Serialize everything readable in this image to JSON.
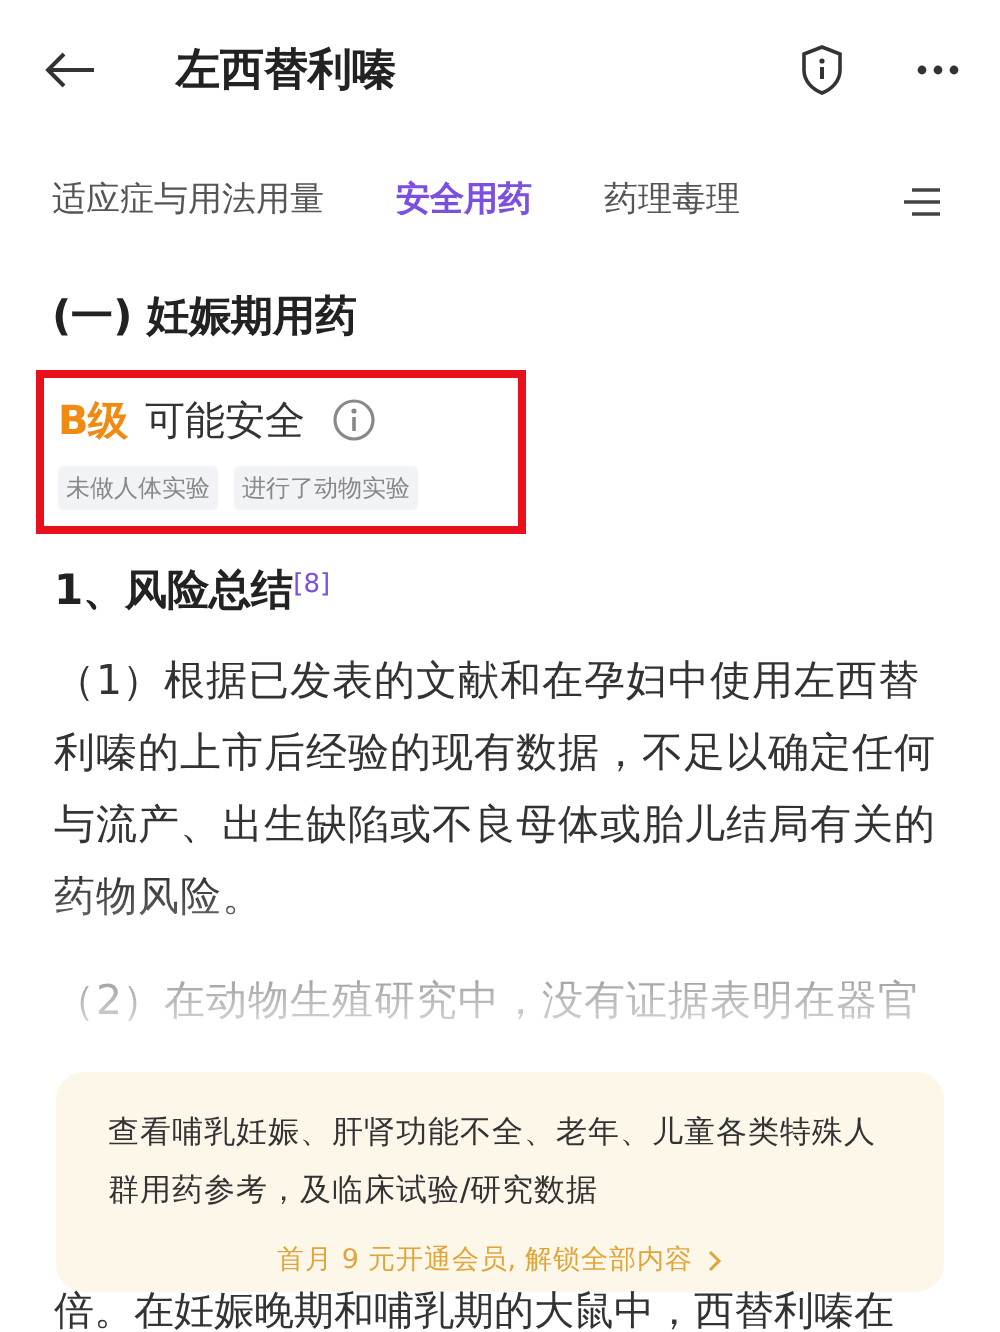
{
  "header": {
    "title": "左西替利嗪"
  },
  "tabs": [
    {
      "label": "适应症与用法用量",
      "selected": false
    },
    {
      "label": "安全用药",
      "selected": true
    },
    {
      "label": "药理毒理",
      "selected": false
    }
  ],
  "section_title": "(一) 妊娠期用药",
  "rating": {
    "grade": "B级",
    "label": "可能安全",
    "tags": [
      "未做人体实验",
      "进行了动物实验"
    ]
  },
  "subheading": "1、风险总结$^{[8]}$",
  "paragraphs": [
    "（1）根据已发表的文献和在孕妇中使用左西替利嗪的上市后经验的现有数据，不足以确定任何与流产、出生缺陷或不良母体或胎儿结局有关的药物风险。",
    "（2）在动物生殖研究中，没有证据表明在器官"
  ],
  "banner": {
    "text": "查看哺乳妊娠、肝肾功能不全、老年、儿童各类特殊人群用药参考，及临床试验/研究数据",
    "action": "首月 9 元开通会员, 解锁全部内容"
  },
  "trailing_line": "倍。在妊娠晚期和哺乳期的大鼠中，西替利嗪在"
}
